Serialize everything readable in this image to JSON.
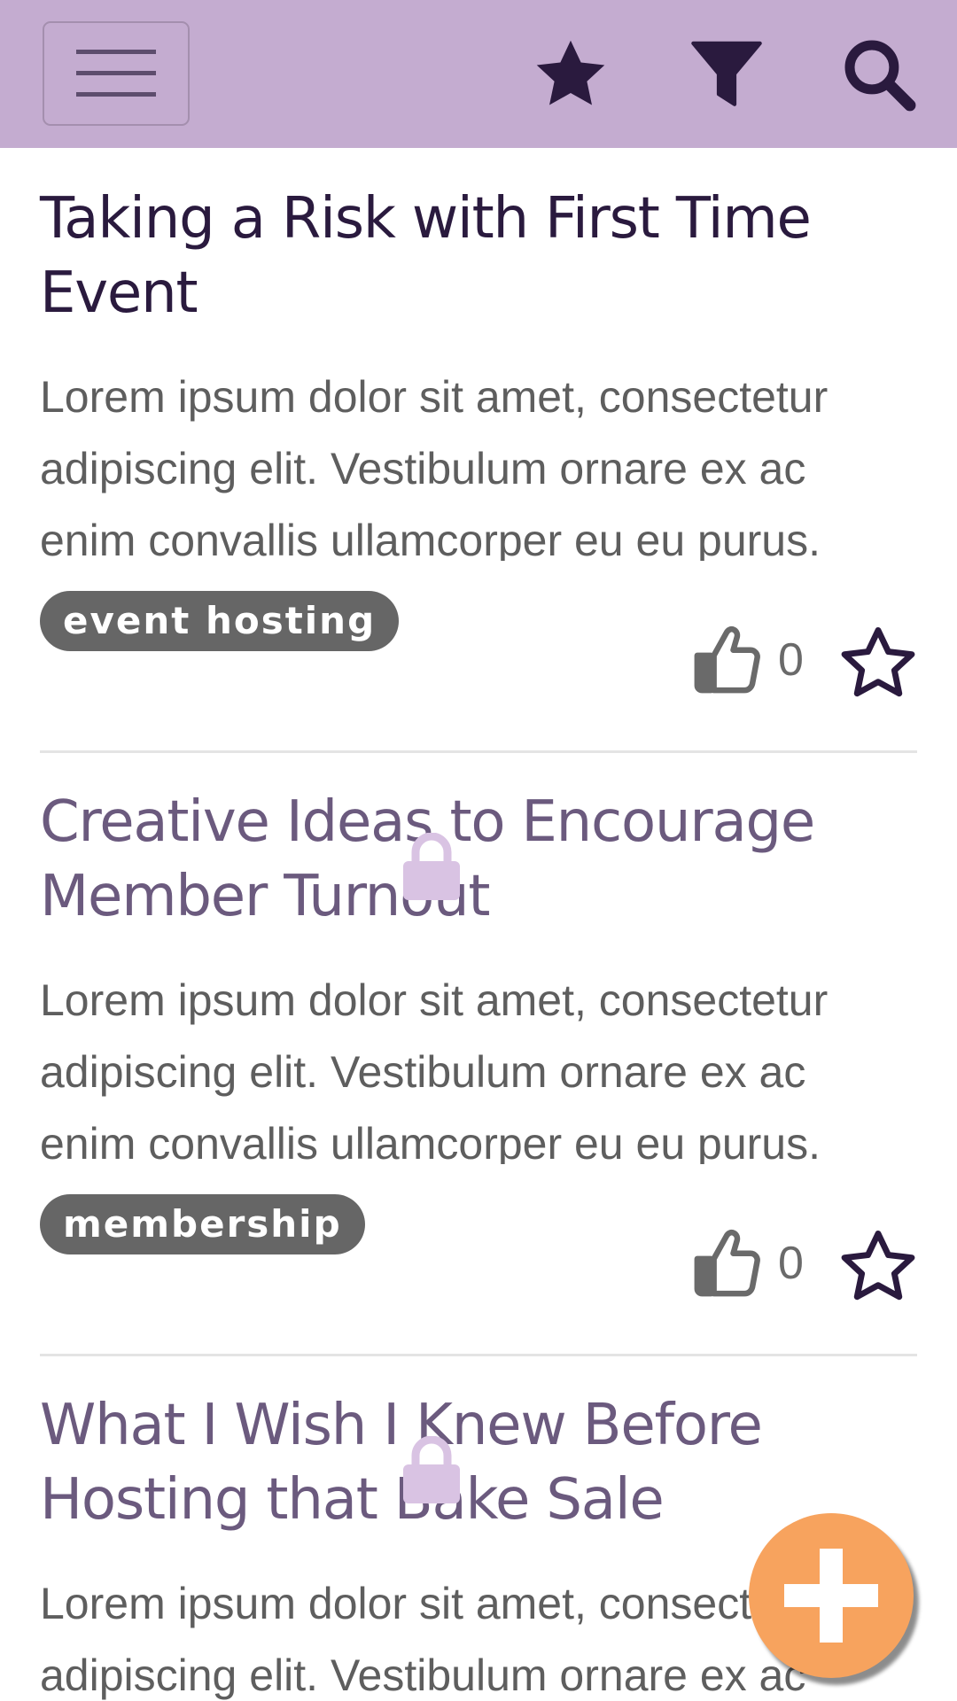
{
  "header": {
    "menu_icon": "hamburger-icon",
    "favorites_icon": "star-icon",
    "filter_icon": "filter-icon",
    "search_icon": "search-icon"
  },
  "posts": [
    {
      "title": "Taking a Risk with First Time Event",
      "body": "Lorem ipsum dolor sit amet, consectetur adipiscing elit. Vestibulum ornare ex ac enim convallis ullamcorper eu eu purus.",
      "tag": "event hosting",
      "likes": "0",
      "locked": false
    },
    {
      "title": "Creative Ideas to Encourage Member Turnout",
      "body": "Lorem ipsum dolor sit amet, consectetur adipiscing elit. Vestibulum ornare ex ac enim convallis ullamcorper eu eu purus.",
      "tag": "membership",
      "likes": "0",
      "locked": true
    },
    {
      "title": "What I Wish I Knew Before Hosting that Bake Sale",
      "body": "Lorem ipsum dolor sit amet, consectetur adipiscing elit. Vestibulum ornare ex ac enim convallis ullamcorper eu eu purus.",
      "locked": true
    }
  ],
  "fab": {
    "icon": "plus-icon"
  },
  "colors": {
    "header_bg": "#c4acd0",
    "title_dark": "#2a1a3e",
    "title_muted": "#6b5a7e",
    "tag_bg": "#666666",
    "fab_bg": "#f7a35e",
    "lock": "#d9c3e3"
  }
}
